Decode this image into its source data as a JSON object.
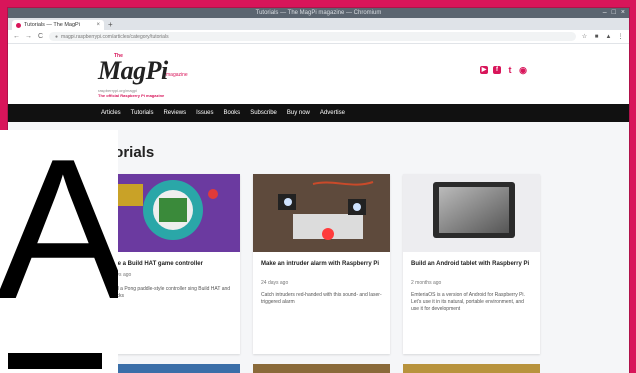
{
  "browser": {
    "window_title": "Tutorials — The MagPi magazine — Chromium",
    "tab_title": "Tutorials — The MagPi",
    "tab_close": "×",
    "new_tab": "+",
    "url": "magpi.raspberrypi.com/articles/category/tutorials",
    "nav": {
      "back": "←",
      "forward": "→",
      "reload": "C"
    },
    "window_controls": [
      "–",
      "□",
      "×"
    ],
    "extensions": [
      "☆",
      "■",
      "▲",
      "⋮"
    ]
  },
  "header": {
    "logo_the": "The",
    "logo_main": "MagPi",
    "logo_magazine": "magazine",
    "logo_tagline": "raspberrypi.org/magpi",
    "logo_subtitle": "The official Raspberry Pi magazine",
    "socials": [
      "▶",
      "f",
      "t",
      "◉"
    ]
  },
  "nav": [
    "Articles",
    "Tutorials",
    "Reviews",
    "Issues",
    "Books",
    "Subscribe",
    "Buy now",
    "Advertise"
  ],
  "section_title": "utorials",
  "cards": [
    {
      "title": "ake a Build HAT game controller",
      "date": "days ago",
      "desc": "uild a Pong paddle-style controller sing Build HAT and bricks"
    },
    {
      "title": "Make an intruder alarm with Raspberry Pi",
      "date": "24 days ago",
      "desc": "Catch intruders red-handed with this sound- and laser-triggered alarm"
    },
    {
      "title": "Build an Android tablet with Raspberry Pi",
      "date": "2 months ago",
      "desc": "EmteriaOS is a version of Android for Raspberry Pi. Let's use it in its natural, portable environment, and use it for development"
    }
  ],
  "overlay_letter": "A",
  "colors": {
    "accent": "#d8155a",
    "nav": "#111111"
  }
}
